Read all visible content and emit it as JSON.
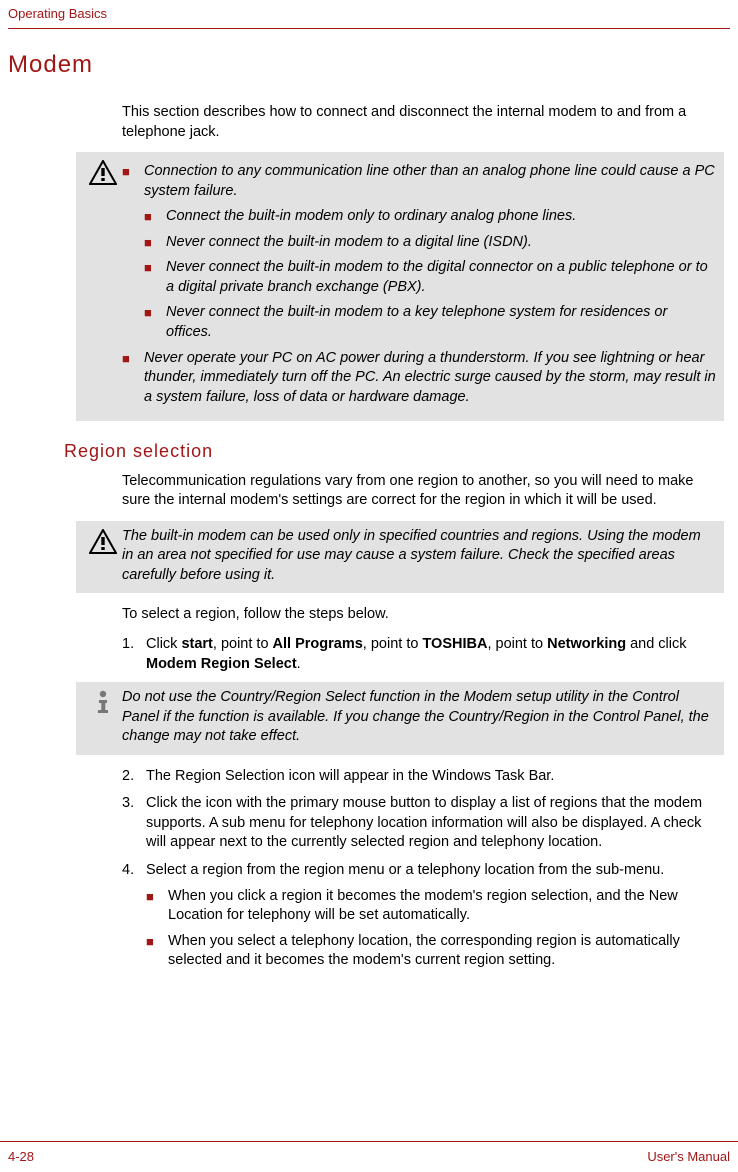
{
  "header": {
    "section": "Operating Basics"
  },
  "title": "Modem",
  "intro": "This section describes how to connect and disconnect the internal modem to and from a telephone jack.",
  "warning1": {
    "lead": "Connection to any communication line other than an analog phone line could cause a PC system failure.",
    "sub": [
      "Connect the built-in modem only to ordinary analog phone lines.",
      "Never connect the built-in modem to a digital line (ISDN).",
      "Never connect the built-in modem to the digital connector on a public telephone or to a digital private branch exchange (PBX).",
      "Never connect the built-in modem to a key telephone system for residences or offices."
    ],
    "tail": "Never operate your PC on AC power during a thunderstorm. If you see lightning or hear thunder, immediately turn off the PC. An electric surge caused by the storm, may result in a system failure, loss of data or hardware damage."
  },
  "region": {
    "heading": "Region selection",
    "intro": "Telecommunication regulations vary from one region to another, so you will need to make sure the internal modem's settings are correct for the region in which it will be used."
  },
  "warning2": "The built-in modem can be used only in specified countries and regions. Using the modem in an area not specified for use may cause a system failure. Check the specified areas carefully before using it.",
  "steps_intro": "To select a region, follow the steps below.",
  "step1": {
    "num": "1.",
    "pre": "Click ",
    "b1": "start",
    "m1": ", point to ",
    "b2": "All Programs",
    "m2": ", point to ",
    "b3": "TOSHIBA",
    "m3": ", point to ",
    "b4": "Networking",
    "m4": " and click ",
    "b5": "Modem Region Select",
    "post": "."
  },
  "info_note": "Do not use the Country/Region Select function in the Modem setup utility in the Control Panel if the function is available. If you change the Country/Region in the Control Panel, the change may not take effect.",
  "step2": {
    "num": "2.",
    "text": "The Region Selection icon will appear in the Windows Task Bar."
  },
  "step3": {
    "num": "3.",
    "text": "Click the icon with the primary mouse button to display a list of regions that the modem supports. A sub menu for telephony location information will also be displayed. A check will appear next to the currently selected region and telephony location."
  },
  "step4": {
    "num": "4.",
    "text": "Select a region from the region menu or a telephony location from the sub-menu.",
    "sub": [
      "When you click a region it becomes the modem's region selection, and the New Location for telephony will be set automatically.",
      "When you select a telephony location, the corresponding region is automatically selected and it becomes the modem's current region setting."
    ]
  },
  "footer": {
    "page": "4-28",
    "manual": "User's Manual"
  }
}
